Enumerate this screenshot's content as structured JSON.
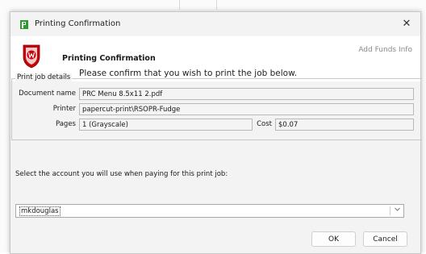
{
  "window": {
    "title": "Printing Confirmation",
    "close_glyph": "✕"
  },
  "header": {
    "title": "Printing Confirmation",
    "message": "Please confirm that you wish to print the job below.",
    "add_funds_link": "Add Funds Info"
  },
  "job_details": {
    "legend": "Print job details",
    "document_label": "Document name",
    "document_value": "PRC Menu 8.5x11 2.pdf",
    "printer_label": "Printer",
    "printer_value": "papercut-print\\RSOPR-Fudge",
    "pages_label": "Pages",
    "pages_value": "1  (Grayscale)",
    "cost_label": "Cost",
    "cost_value": "$0.07"
  },
  "account": {
    "prompt": "Select the account you will use when paying for this print job:",
    "selected": "mkdouglas"
  },
  "buttons": {
    "ok": "OK",
    "cancel": "Cancel"
  },
  "icons": {
    "app": "papercut-p-icon",
    "crest": "university-crest-icon"
  },
  "colors": {
    "app_icon_green": "#2e9b2e",
    "crest_red": "#c5050c"
  }
}
